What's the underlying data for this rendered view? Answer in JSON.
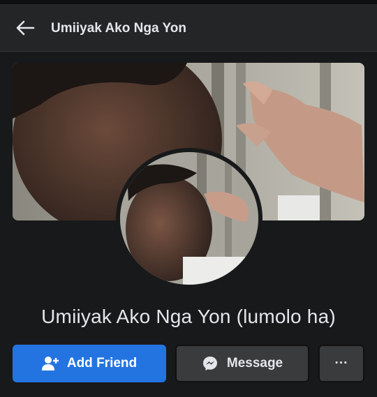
{
  "header": {
    "title": "Umiiyak Ako Nga Yon",
    "back_icon": "arrow-left-icon"
  },
  "profile": {
    "name": "Umiiyak Ako Nga Yon (lumolo ha)"
  },
  "actions": {
    "add_friend_label": "Add Friend",
    "message_label": "Message",
    "more_label": "···"
  },
  "colors": {
    "background": "#18191a",
    "primary_button": "#2374e1",
    "secondary_button": "#3a3b3c"
  }
}
